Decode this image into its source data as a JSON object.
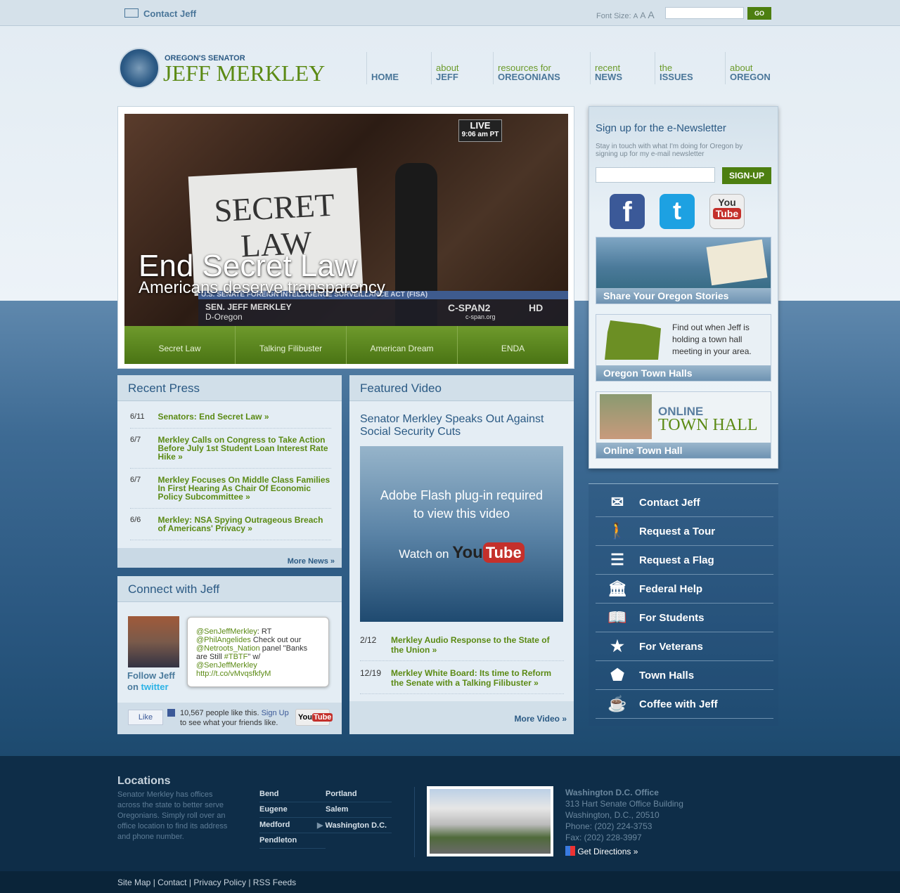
{
  "topbar": {
    "contact": "Contact Jeff",
    "font_size_label": "Font Size:",
    "font_sizes": [
      "A",
      "A",
      "A"
    ],
    "search_placeholder": "",
    "go": "GO"
  },
  "logo": {
    "sub": "OREGON'S SENATOR",
    "name": "JEFF MERKLEY"
  },
  "nav": [
    {
      "small": "",
      "big": "HOME"
    },
    {
      "small": "about",
      "big": "JEFF"
    },
    {
      "small": "resources for",
      "big": "OREGONIANS"
    },
    {
      "small": "recent",
      "big": "NEWS"
    },
    {
      "small": "the",
      "big": "ISSUES"
    },
    {
      "small": "about",
      "big": "OREGON"
    }
  ],
  "hero": {
    "title": "End Secret Law",
    "subtitle": "Americans deserve transparency",
    "sign_line1": "SECRET",
    "sign_line2": "LAW",
    "live": "LIVE",
    "time": "9:06 am PT",
    "chyron_top": "U.S. SENATE  FOREIGN INTELLIGENCE SURVEILLANCE ACT (FISA)",
    "chyron_name": "SEN. JEFF MERKLEY",
    "chyron_state": "D-Oregon",
    "network": "C-SPAN2",
    "hd": "HD",
    "url": "c-span.org",
    "tabs": [
      "Secret Law",
      "Talking Filibuster",
      "American Dream",
      "ENDA"
    ]
  },
  "newsletter": {
    "title": "Sign up for the e-Newsletter",
    "desc": "Stay in touch with what I'm doing for Oregon by signing up for my e-mail newsletter",
    "placeholder": "",
    "button": "SIGN-UP"
  },
  "social": {
    "facebook": "f",
    "twitter": "t",
    "youtube_you": "You",
    "youtube_tube": "Tube"
  },
  "promos": {
    "stories": "Share Your Oregon Stories",
    "townhalls_text": "Find out when Jeff is holding a town hall meeting in your area.",
    "townhalls": "Oregon Town Halls",
    "online_top": "ONLINE",
    "online_bottom": "TOWN HALL",
    "online": "Online Town Hall"
  },
  "recent_press": {
    "title": "Recent Press",
    "items": [
      {
        "date": "6/11",
        "title": "Senators: End Secret Law »"
      },
      {
        "date": "6/7",
        "title": "Merkley Calls on Congress to Take Action Before July 1st Student Loan Interest Rate Hike  »"
      },
      {
        "date": "6/7",
        "title": "Merkley Focuses On Middle Class Families In First Hearing As Chair Of Economic Policy Subcommittee »"
      },
      {
        "date": "6/6",
        "title": "Merkley: NSA Spying Outrageous Breach of Americans' Privacy »"
      }
    ],
    "more": "More News »"
  },
  "connect": {
    "title": "Connect with Jeff",
    "follow1": "Follow Jeff",
    "follow2": "on",
    "follow3": "twitter",
    "tweet": {
      "h1": "@SenJeffMerkley",
      "t1": ": RT ",
      "h2": "@PhilAngelides",
      "t2": " Check out our ",
      "h3": "@Netroots_Nation",
      "t3": " panel \"Banks are Still ",
      "h4": "#TBTF",
      "t4": "\" w/ ",
      "h5": "@SenJeffMerkley",
      "link": "http://t.co/vMvqsfkfyM"
    },
    "like": "Like",
    "likes": "10,567 people like this.",
    "signup": "Sign Up",
    "likes_rest": "to see what your friends like."
  },
  "featured": {
    "title": "Featured Video",
    "video_title": "Senator Merkley Speaks Out Against Social Security Cuts",
    "flash1": "Adobe Flash plug-in required",
    "flash2": "to view this video",
    "watch": "Watch on",
    "items": [
      {
        "date": "2/12",
        "title": "Merkley Audio Response to the State of the Union »"
      },
      {
        "date": "12/19",
        "title": "Merkley White Board: Its time to Reform the Senate with a Talking Filibuster »"
      }
    ],
    "more": "More Video »"
  },
  "quicklinks": [
    {
      "icon": "envelope-icon",
      "glyph": "✉",
      "label": "Contact Jeff"
    },
    {
      "icon": "walking-person-icon",
      "glyph": "🚶",
      "label": "Request a Tour"
    },
    {
      "icon": "flag-icon",
      "glyph": "☰",
      "label": "Request a Flag"
    },
    {
      "icon": "capitol-building-icon",
      "glyph": "🏛",
      "label": "Federal Help"
    },
    {
      "icon": "book-icon",
      "glyph": "📖",
      "label": "For Students"
    },
    {
      "icon": "star-icon",
      "glyph": "★",
      "label": "For Veterans"
    },
    {
      "icon": "oregon-map-icon",
      "glyph": "⬟",
      "label": "Town Halls"
    },
    {
      "icon": "coffee-cup-icon",
      "glyph": "☕",
      "label": "Coffee with Jeff"
    }
  ],
  "footer": {
    "locations_title": "Locations",
    "locations_desc": "Senator Merkley has offices across the state to better serve Oregonians. Simply roll over an office location to find its address and phone number.",
    "locations": [
      "Bend",
      "Portland",
      "Eugene",
      "Salem",
      "Medford",
      "Washington D.C.",
      "Pendleton"
    ],
    "office": {
      "title": "Washington D.C. Office",
      "addr1": "313 Hart Senate Office Building",
      "addr2": "Washington, D.C., 20510",
      "phone": "Phone: (202) 224-3753",
      "fax": "Fax: (202) 228-3997",
      "directions": "Get Directions »"
    },
    "links": [
      "Site Map",
      "Contact",
      "Privacy Policy",
      "RSS Feeds"
    ]
  }
}
